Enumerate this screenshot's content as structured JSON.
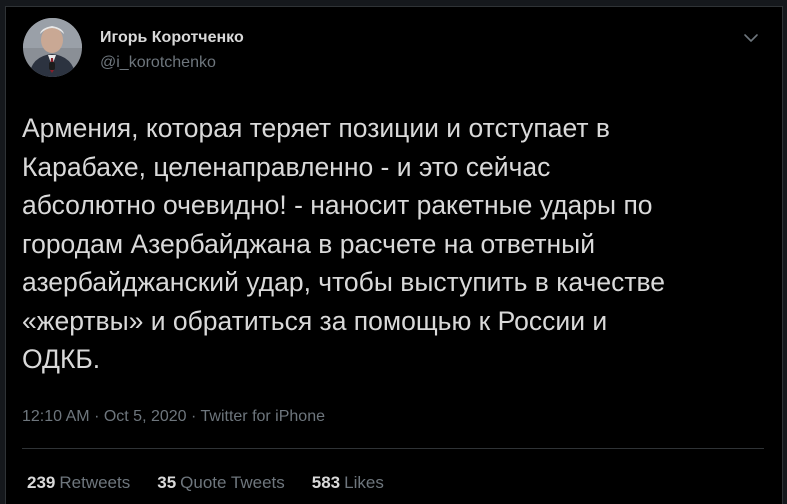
{
  "author": {
    "name": "Игорь Коротченко",
    "handle": "@i_korotchenko"
  },
  "tweet": {
    "text": "Армения, которая теряет позиции и отступает в\nКарабахе, целенаправленно - и это сейчас\nабсолютно очевидно! - наносит ракетные удары по\nгородам Азербайджана в расчете на ответный\nазербайджанский удар, чтобы выступить в качестве\n«жертвы» и обратиться за помощью к России и\nОДКБ.",
    "time": "12:10 AM",
    "separator": "·",
    "date": "Oct 5, 2020",
    "source": "Twitter for iPhone"
  },
  "stats": {
    "retweets_count": "239",
    "retweets_label": "Retweets",
    "quotes_count": "35",
    "quotes_label": "Quote Tweets",
    "likes_count": "583",
    "likes_label": "Likes"
  },
  "icons": {
    "menu": "chevron-down-icon"
  },
  "colors": {
    "background": "#000000",
    "text_primary": "#d9d9d9",
    "text_secondary": "#6e767d",
    "divider": "#2f3336"
  }
}
